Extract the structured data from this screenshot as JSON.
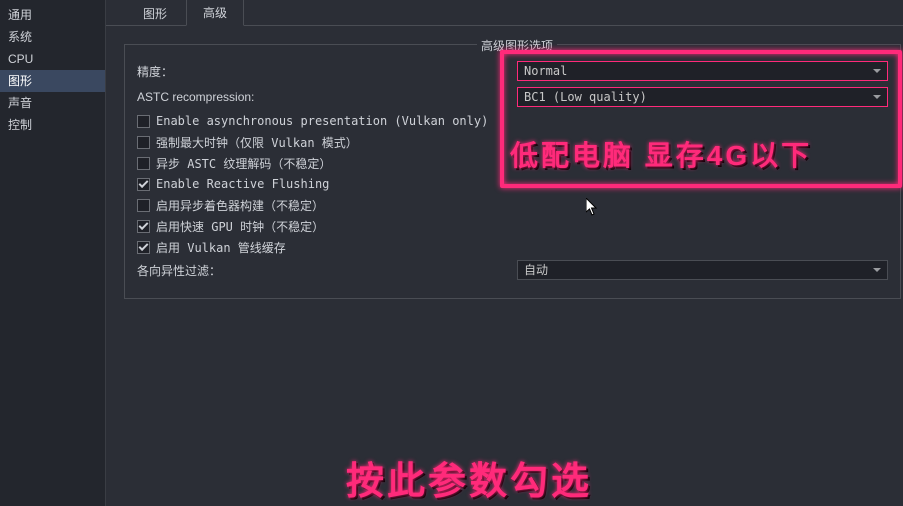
{
  "sidebar": {
    "items": [
      {
        "label": "通用"
      },
      {
        "label": "系统"
      },
      {
        "label": "CPU"
      },
      {
        "label": "图形",
        "active": true
      },
      {
        "label": "声音"
      },
      {
        "label": "控制"
      }
    ]
  },
  "tabs": [
    {
      "label": "图形"
    },
    {
      "label": "高级",
      "active": true
    }
  ],
  "group_title": "高级图形选项",
  "rows": {
    "precision_label": "精度：",
    "precision_value": "Normal",
    "astc_label": "ASTC recompression:",
    "astc_value": "BC1 (Low quality)",
    "aniso_label": "各向异性过滤：",
    "aniso_value": "自动"
  },
  "checks": [
    {
      "label": "Enable asynchronous presentation (Vulkan only)",
      "checked": false
    },
    {
      "label": "强制最大时钟（仅限 Vulkan 模式）",
      "checked": false
    },
    {
      "label": "异步 ASTC 纹理解码（不稳定）",
      "checked": false
    },
    {
      "label": "Enable Reactive Flushing",
      "checked": true
    },
    {
      "label": "启用异步着色器构建（不稳定）",
      "checked": false
    },
    {
      "label": "启用快速 GPU 时钟（不稳定）",
      "checked": true
    },
    {
      "label": "启用 Vulkan 管线缓存",
      "checked": true
    }
  ],
  "overlay": {
    "text1": "低配电脑 显存4G以下",
    "text2": "按此参数勾选"
  }
}
